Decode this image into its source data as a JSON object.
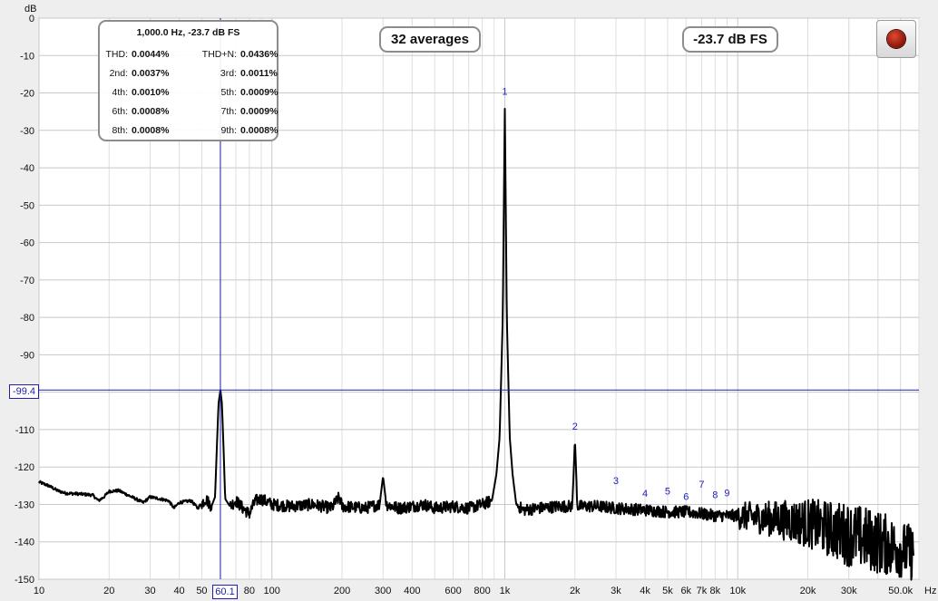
{
  "toolbar": {
    "record_button_icon": "record-icon"
  },
  "overlays": {
    "averages": "32 averages",
    "level": "-23.7 dB FS",
    "cursor_y_value": "-99.4",
    "cursor_x_value": "60.1"
  },
  "thd_panel": {
    "title": "1,000.0 Hz, -23.7 dB FS",
    "rows": [
      {
        "k1": "THD:",
        "v1": "0.0044%",
        "k2": "THD+N:",
        "v2": "0.0436%"
      },
      {
        "k1": "2nd:",
        "v1": "0.0037%",
        "k2": "3rd:",
        "v2": "0.0011%"
      },
      {
        "k1": "4th:",
        "v1": "0.0010%",
        "k2": "5th:",
        "v2": "0.0009%"
      },
      {
        "k1": "6th:",
        "v1": "0.0008%",
        "k2": "7th:",
        "v2": "0.0009%"
      },
      {
        "k1": "8th:",
        "v1": "0.0008%",
        "k2": "9th:",
        "v2": "0.0008%"
      }
    ]
  },
  "colors": {
    "trace": "#000000",
    "cursor": "#2020a8",
    "harmonic_labels": "#2020c0",
    "plot_background": "#ffffff"
  },
  "chart_data": {
    "type": "line",
    "x_scale": "log",
    "xlim": [
      10,
      60000
    ],
    "ylim": [
      -150,
      0
    ],
    "ylabel": "dB",
    "xlabel_unit": "Hz",
    "grid": true,
    "y_ticks": [
      0,
      -10,
      -20,
      -30,
      -40,
      -50,
      -60,
      -70,
      -80,
      -90,
      -110,
      -120,
      -130,
      -140,
      -150
    ],
    "y_tick_labels": [
      "0",
      "-10",
      "-20",
      "-30",
      "-40",
      "-50",
      "-60",
      "-70",
      "-80",
      "-90",
      "-110",
      "-120",
      "-130",
      "-140",
      "-150"
    ],
    "x_ticks": [
      10,
      20,
      30,
      40,
      50,
      80,
      100,
      200,
      300,
      400,
      600,
      800,
      1000,
      2000,
      3000,
      4000,
      5000,
      6000,
      7000,
      8000,
      10000,
      20000,
      30000,
      50000
    ],
    "x_tick_labels": [
      "10",
      "20",
      "30",
      "40",
      "50",
      "80",
      "100",
      "200",
      "300",
      "400",
      "600",
      "800",
      "1k",
      "2k",
      "3k",
      "4k",
      "5k",
      "6k",
      "7k",
      "8k",
      "10k",
      "20k",
      "30k",
      "50.0k"
    ],
    "cursor": {
      "x": 60.1,
      "y": -99.4
    },
    "series": [
      {
        "points": [
          [
            10,
            -124
          ],
          [
            11,
            -125
          ],
          [
            12,
            -126.3
          ],
          [
            13,
            -127
          ],
          [
            15,
            -127.2
          ],
          [
            17,
            -127.5
          ],
          [
            18,
            -129
          ],
          [
            19,
            -128
          ],
          [
            20,
            -126.5
          ],
          [
            22,
            -126.3
          ],
          [
            25,
            -128
          ],
          [
            28,
            -129.5
          ],
          [
            30,
            -128
          ],
          [
            33,
            -128.5
          ],
          [
            36,
            -129
          ],
          [
            38,
            -131
          ],
          [
            40,
            -129.5
          ],
          [
            45,
            -129
          ],
          [
            48,
            -131
          ],
          [
            52,
            -128.5
          ],
          [
            55,
            -130.5
          ],
          [
            57,
            -128
          ],
          [
            58,
            -115
          ],
          [
            59,
            -103
          ],
          [
            60.1,
            -99.4
          ],
          [
            61,
            -103
          ],
          [
            62,
            -115
          ],
          [
            63,
            -128.5
          ],
          [
            66,
            -130.5
          ],
          [
            70,
            -129
          ],
          [
            75,
            -131
          ],
          [
            80,
            -132.5
          ],
          [
            85,
            -129
          ],
          [
            90,
            -128.5
          ],
          [
            100,
            -130
          ],
          [
            120,
            -130.5
          ],
          [
            150,
            -130
          ],
          [
            180,
            -131
          ],
          [
            195,
            -128
          ],
          [
            200,
            -130.5
          ],
          [
            250,
            -131
          ],
          [
            290,
            -130
          ],
          [
            300,
            -122.5
          ],
          [
            310,
            -130
          ],
          [
            350,
            -131
          ],
          [
            400,
            -130.5
          ],
          [
            450,
            -130
          ],
          [
            500,
            -131
          ],
          [
            600,
            -130.5
          ],
          [
            700,
            -131
          ],
          [
            800,
            -130
          ],
          [
            880,
            -129
          ],
          [
            920,
            -122
          ],
          [
            950,
            -112
          ],
          [
            980,
            -80
          ],
          [
            1000,
            -23.7
          ],
          [
            1020,
            -80
          ],
          [
            1050,
            -112
          ],
          [
            1080,
            -122
          ],
          [
            1120,
            -130
          ],
          [
            1200,
            -131.5
          ],
          [
            1400,
            -131
          ],
          [
            1700,
            -130.5
          ],
          [
            1950,
            -130.5
          ],
          [
            2000,
            -112.5
          ],
          [
            2050,
            -130.5
          ],
          [
            2500,
            -130.5
          ],
          [
            3000,
            -131
          ],
          [
            4000,
            -131.5
          ],
          [
            5000,
            -132
          ],
          [
            6000,
            -132
          ],
          [
            7000,
            -132.5
          ],
          [
            8000,
            -133
          ],
          [
            10000,
            -133
          ],
          [
            15000,
            -134
          ],
          [
            20000,
            -135
          ],
          [
            30000,
            -138
          ],
          [
            40000,
            -140
          ],
          [
            50000,
            -142
          ],
          [
            57000,
            -143
          ]
        ],
        "noise_envelope": [
          [
            10000,
            2
          ],
          [
            20000,
            5
          ],
          [
            30000,
            7
          ],
          [
            40000,
            7
          ],
          [
            50000,
            6
          ],
          [
            57000,
            6
          ]
        ]
      }
    ],
    "peak_labels": [
      {
        "label": "1",
        "x": 1000,
        "y": -20.5
      },
      {
        "label": "2",
        "x": 2000,
        "y": -110
      },
      {
        "label": "3",
        "x": 3000,
        "y": -124.5
      },
      {
        "label": "4",
        "x": 4000,
        "y": -128
      },
      {
        "label": "5",
        "x": 5000,
        "y": -127.3
      },
      {
        "label": "6",
        "x": 6000,
        "y": -128.8
      },
      {
        "label": "7",
        "x": 7000,
        "y": -125.5
      },
      {
        "label": "8",
        "x": 8000,
        "y": -128.3
      },
      {
        "label": "9",
        "x": 9000,
        "y": -127.8
      }
    ]
  }
}
